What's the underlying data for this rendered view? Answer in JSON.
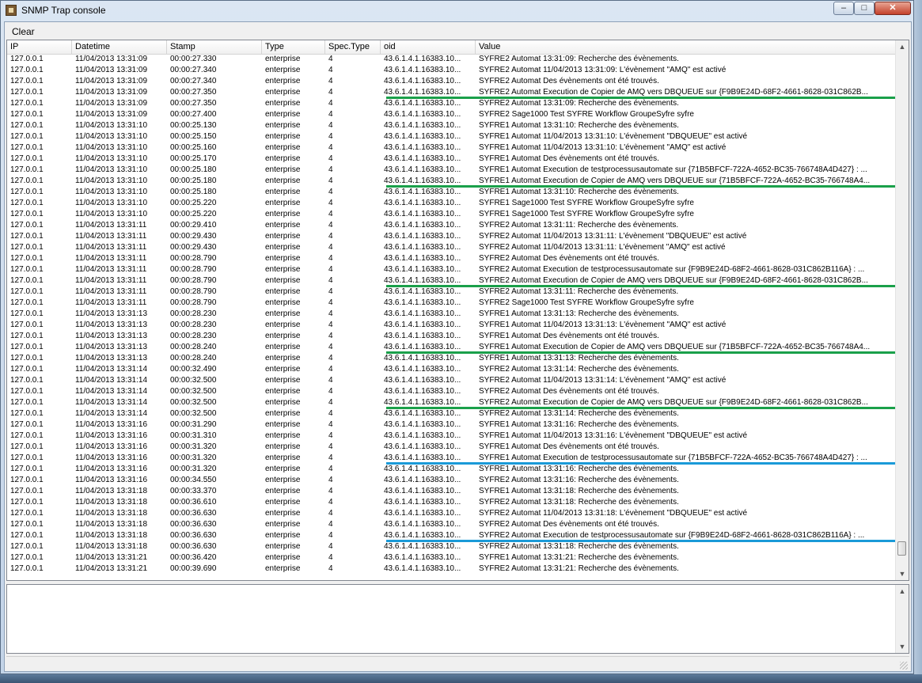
{
  "window": {
    "title": "SNMP Trap console",
    "controls": {
      "minimize": "–",
      "maximize": "□",
      "close": "✕"
    }
  },
  "toolbar": {
    "clear_label": "Clear"
  },
  "grid": {
    "columns": [
      "IP",
      "Datetime",
      "Stamp",
      "Type",
      "Spec.Type",
      "oid",
      "Value"
    ],
    "rows": [
      [
        "127.0.0.1",
        "11/04/2013 13:31:09",
        "00:00:27.330",
        "enterprise",
        "4",
        "43.6.1.4.1.16383.10...",
        "SYFRE2 Automat 13:31:09: Recherche des évènements."
      ],
      [
        "127.0.0.1",
        "11/04/2013 13:31:09",
        "00:00:27.340",
        "enterprise",
        "4",
        "43.6.1.4.1.16383.10...",
        "SYFRE2 Automat 11/04/2013 13:31:09: L'évènement \"AMQ\" est activé"
      ],
      [
        "127.0.0.1",
        "11/04/2013 13:31:09",
        "00:00:27.340",
        "enterprise",
        "4",
        "43.6.1.4.1.16383.10...",
        "SYFRE2 Automat Des évènements ont été trouvés."
      ],
      [
        "127.0.0.1",
        "11/04/2013 13:31:09",
        "00:00:27.350",
        "enterprise",
        "4",
        "43.6.1.4.1.16383.10...",
        "SYFRE2 Automat Execution de Copier de AMQ vers DBQUEUE sur {F9B9E24D-68F2-4661-8628-031C862B..."
      ],
      [
        "127.0.0.1",
        "11/04/2013 13:31:09",
        "00:00:27.350",
        "enterprise",
        "4",
        "43.6.1.4.1.16383.10...",
        "SYFRE2 Automat 13:31:09: Recherche des évènements."
      ],
      [
        "127.0.0.1",
        "11/04/2013 13:31:09",
        "00:00:27.400",
        "enterprise",
        "4",
        "43.6.1.4.1.16383.10...",
        "SYFRE2  Sage1000 Test SYFRE Workflow  GroupeSyfre syfre"
      ],
      [
        "127.0.0.1",
        "11/04/2013 13:31:10",
        "00:00:25.130",
        "enterprise",
        "4",
        "43.6.1.4.1.16383.10...",
        "SYFRE1 Automat 13:31:10: Recherche des évènements."
      ],
      [
        "127.0.0.1",
        "11/04/2013 13:31:10",
        "00:00:25.150",
        "enterprise",
        "4",
        "43.6.1.4.1.16383.10...",
        "SYFRE1 Automat 11/04/2013 13:31:10: L'évènement \"DBQUEUE\" est activé"
      ],
      [
        "127.0.0.1",
        "11/04/2013 13:31:10",
        "00:00:25.160",
        "enterprise",
        "4",
        "43.6.1.4.1.16383.10...",
        "SYFRE1 Automat 11/04/2013 13:31:10: L'évènement \"AMQ\" est activé"
      ],
      [
        "127.0.0.1",
        "11/04/2013 13:31:10",
        "00:00:25.170",
        "enterprise",
        "4",
        "43.6.1.4.1.16383.10...",
        "SYFRE1 Automat Des évènements ont été trouvés."
      ],
      [
        "127.0.0.1",
        "11/04/2013 13:31:10",
        "00:00:25.180",
        "enterprise",
        "4",
        "43.6.1.4.1.16383.10...",
        "SYFRE1 Automat Execution de testprocessusautomate sur {71B5BFCF-722A-4652-BC35-766748A4D427} : ..."
      ],
      [
        "127.0.0.1",
        "11/04/2013 13:31:10",
        "00:00:25.180",
        "enterprise",
        "4",
        "43.6.1.4.1.16383.10...",
        "SYFRE1 Automat Execution de Copier de AMQ vers DBQUEUE sur {71B5BFCF-722A-4652-BC35-766748A4..."
      ],
      [
        "127.0.0.1",
        "11/04/2013 13:31:10",
        "00:00:25.180",
        "enterprise",
        "4",
        "43.6.1.4.1.16383.10...",
        "SYFRE1 Automat 13:31:10: Recherche des évènements."
      ],
      [
        "127.0.0.1",
        "11/04/2013 13:31:10",
        "00:00:25.220",
        "enterprise",
        "4",
        "43.6.1.4.1.16383.10...",
        "SYFRE1  Sage1000 Test SYFRE Workflow  GroupeSyfre syfre"
      ],
      [
        "127.0.0.1",
        "11/04/2013 13:31:10",
        "00:00:25.220",
        "enterprise",
        "4",
        "43.6.1.4.1.16383.10...",
        "SYFRE1  Sage1000 Test SYFRE Workflow  GroupeSyfre syfre"
      ],
      [
        "127.0.0.1",
        "11/04/2013 13:31:11",
        "00:00:29.410",
        "enterprise",
        "4",
        "43.6.1.4.1.16383.10...",
        "SYFRE2 Automat 13:31:11: Recherche des évènements."
      ],
      [
        "127.0.0.1",
        "11/04/2013 13:31:11",
        "00:00:29.430",
        "enterprise",
        "4",
        "43.6.1.4.1.16383.10...",
        "SYFRE2 Automat 11/04/2013 13:31:11: L'évènement \"DBQUEUE\" est activé"
      ],
      [
        "127.0.0.1",
        "11/04/2013 13:31:11",
        "00:00:29.430",
        "enterprise",
        "4",
        "43.6.1.4.1.16383.10...",
        "SYFRE2 Automat 11/04/2013 13:31:11: L'évènement \"AMQ\" est activé"
      ],
      [
        "127.0.0.1",
        "11/04/2013 13:31:11",
        "00:00:28.790",
        "enterprise",
        "4",
        "43.6.1.4.1.16383.10...",
        "SYFRE2 Automat Des évènements ont été trouvés."
      ],
      [
        "127.0.0.1",
        "11/04/2013 13:31:11",
        "00:00:28.790",
        "enterprise",
        "4",
        "43.6.1.4.1.16383.10...",
        "SYFRE2 Automat Execution de testprocessusautomate sur {F9B9E24D-68F2-4661-8628-031C862B116A} : ..."
      ],
      [
        "127.0.0.1",
        "11/04/2013 13:31:11",
        "00:00:28.790",
        "enterprise",
        "4",
        "43.6.1.4.1.16383.10...",
        "SYFRE2 Automat Execution de Copier de AMQ vers DBQUEUE sur {F9B9E24D-68F2-4661-8628-031C862B..."
      ],
      [
        "127.0.0.1",
        "11/04/2013 13:31:11",
        "00:00:28.790",
        "enterprise",
        "4",
        "43.6.1.4.1.16383.10...",
        "SYFRE2 Automat 13:31:11: Recherche des évènements."
      ],
      [
        "127.0.0.1",
        "11/04/2013 13:31:11",
        "00:00:28.790",
        "enterprise",
        "4",
        "43.6.1.4.1.16383.10...",
        "SYFRE2  Sage1000 Test SYFRE Workflow  GroupeSyfre syfre"
      ],
      [
        "127.0.0.1",
        "11/04/2013 13:31:13",
        "00:00:28.230",
        "enterprise",
        "4",
        "43.6.1.4.1.16383.10...",
        "SYFRE1 Automat 13:31:13: Recherche des évènements."
      ],
      [
        "127.0.0.1",
        "11/04/2013 13:31:13",
        "00:00:28.230",
        "enterprise",
        "4",
        "43.6.1.4.1.16383.10...",
        "SYFRE1 Automat 11/04/2013 13:31:13: L'évènement \"AMQ\" est activé"
      ],
      [
        "127.0.0.1",
        "11/04/2013 13:31:13",
        "00:00:28.230",
        "enterprise",
        "4",
        "43.6.1.4.1.16383.10...",
        "SYFRE1 Automat Des évènements ont été trouvés."
      ],
      [
        "127.0.0.1",
        "11/04/2013 13:31:13",
        "00:00:28.240",
        "enterprise",
        "4",
        "43.6.1.4.1.16383.10...",
        "SYFRE1 Automat Execution de Copier de AMQ vers DBQUEUE sur {71B5BFCF-722A-4652-BC35-766748A4..."
      ],
      [
        "127.0.0.1",
        "11/04/2013 13:31:13",
        "00:00:28.240",
        "enterprise",
        "4",
        "43.6.1.4.1.16383.10...",
        "SYFRE1 Automat 13:31:13: Recherche des évènements."
      ],
      [
        "127.0.0.1",
        "11/04/2013 13:31:14",
        "00:00:32.490",
        "enterprise",
        "4",
        "43.6.1.4.1.16383.10...",
        "SYFRE2 Automat 13:31:14: Recherche des évènements."
      ],
      [
        "127.0.0.1",
        "11/04/2013 13:31:14",
        "00:00:32.500",
        "enterprise",
        "4",
        "43.6.1.4.1.16383.10...",
        "SYFRE2 Automat 11/04/2013 13:31:14: L'évènement \"AMQ\" est activé"
      ],
      [
        "127.0.0.1",
        "11/04/2013 13:31:14",
        "00:00:32.500",
        "enterprise",
        "4",
        "43.6.1.4.1.16383.10...",
        "SYFRE2 Automat Des évènements ont été trouvés."
      ],
      [
        "127.0.0.1",
        "11/04/2013 13:31:14",
        "00:00:32.500",
        "enterprise",
        "4",
        "43.6.1.4.1.16383.10...",
        "SYFRE2 Automat Execution de Copier de AMQ vers DBQUEUE sur {F9B9E24D-68F2-4661-8628-031C862B..."
      ],
      [
        "127.0.0.1",
        "11/04/2013 13:31:14",
        "00:00:32.500",
        "enterprise",
        "4",
        "43.6.1.4.1.16383.10...",
        "SYFRE2 Automat 13:31:14: Recherche des évènements."
      ],
      [
        "127.0.0.1",
        "11/04/2013 13:31:16",
        "00:00:31.290",
        "enterprise",
        "4",
        "43.6.1.4.1.16383.10...",
        "SYFRE1 Automat 13:31:16: Recherche des évènements."
      ],
      [
        "127.0.0.1",
        "11/04/2013 13:31:16",
        "00:00:31.310",
        "enterprise",
        "4",
        "43.6.1.4.1.16383.10...",
        "SYFRE1 Automat 11/04/2013 13:31:16: L'évènement \"DBQUEUE\" est activé"
      ],
      [
        "127.0.0.1",
        "11/04/2013 13:31:16",
        "00:00:31.320",
        "enterprise",
        "4",
        "43.6.1.4.1.16383.10...",
        "SYFRE1 Automat Des évènements ont été trouvés."
      ],
      [
        "127.0.0.1",
        "11/04/2013 13:31:16",
        "00:00:31.320",
        "enterprise",
        "4",
        "43.6.1.4.1.16383.10...",
        "SYFRE1 Automat Execution de testprocessusautomate sur {71B5BFCF-722A-4652-BC35-766748A4D427} : ..."
      ],
      [
        "127.0.0.1",
        "11/04/2013 13:31:16",
        "00:00:31.320",
        "enterprise",
        "4",
        "43.6.1.4.1.16383.10...",
        "SYFRE1 Automat 13:31:16: Recherche des évènements."
      ],
      [
        "127.0.0.1",
        "11/04/2013 13:31:16",
        "00:00:34.550",
        "enterprise",
        "4",
        "43.6.1.4.1.16383.10...",
        "SYFRE2 Automat 13:31:16: Recherche des évènements."
      ],
      [
        "127.0.0.1",
        "11/04/2013 13:31:18",
        "00:00:33.370",
        "enterprise",
        "4",
        "43.6.1.4.1.16383.10...",
        "SYFRE1 Automat 13:31:18: Recherche des évènements."
      ],
      [
        "127.0.0.1",
        "11/04/2013 13:31:18",
        "00:00:36.610",
        "enterprise",
        "4",
        "43.6.1.4.1.16383.10...",
        "SYFRE2 Automat 13:31:18: Recherche des évènements."
      ],
      [
        "127.0.0.1",
        "11/04/2013 13:31:18",
        "00:00:36.630",
        "enterprise",
        "4",
        "43.6.1.4.1.16383.10...",
        "SYFRE2 Automat 11/04/2013 13:31:18: L'évènement \"DBQUEUE\" est activé"
      ],
      [
        "127.0.0.1",
        "11/04/2013 13:31:18",
        "00:00:36.630",
        "enterprise",
        "4",
        "43.6.1.4.1.16383.10...",
        "SYFRE2 Automat Des évènements ont été trouvés."
      ],
      [
        "127.0.0.1",
        "11/04/2013 13:31:18",
        "00:00:36.630",
        "enterprise",
        "4",
        "43.6.1.4.1.16383.10...",
        "SYFRE2 Automat Execution de testprocessusautomate sur {F9B9E24D-68F2-4661-8628-031C862B116A} : ..."
      ],
      [
        "127.0.0.1",
        "11/04/2013 13:31:18",
        "00:00:36.630",
        "enterprise",
        "4",
        "43.6.1.4.1.16383.10...",
        "SYFRE2 Automat 13:31:18: Recherche des évènements."
      ],
      [
        "127.0.0.1",
        "11/04/2013 13:31:21",
        "00:00:36.420",
        "enterprise",
        "4",
        "43.6.1.4.1.16383.10...",
        "SYFRE1 Automat 13:31:21: Recherche des évènements."
      ],
      [
        "127.0.0.1",
        "11/04/2013 13:31:21",
        "00:00:39.690",
        "enterprise",
        "4",
        "43.6.1.4.1.16383.10...",
        "SYFRE2 Automat 13:31:21: Recherche des évènements."
      ]
    ],
    "highlights": [
      {
        "row": 3,
        "color": "#1aa04a"
      },
      {
        "row": 11,
        "color": "#1aa04a"
      },
      {
        "row": 20,
        "color": "#1aa04a"
      },
      {
        "row": 26,
        "color": "#1aa04a"
      },
      {
        "row": 31,
        "color": "#1aa04a"
      },
      {
        "row": 36,
        "color": "#1a9ad8"
      },
      {
        "row": 43,
        "color": "#1a9ad8"
      }
    ]
  },
  "scrollbar_icons": {
    "up": "▲",
    "down": "▼"
  }
}
